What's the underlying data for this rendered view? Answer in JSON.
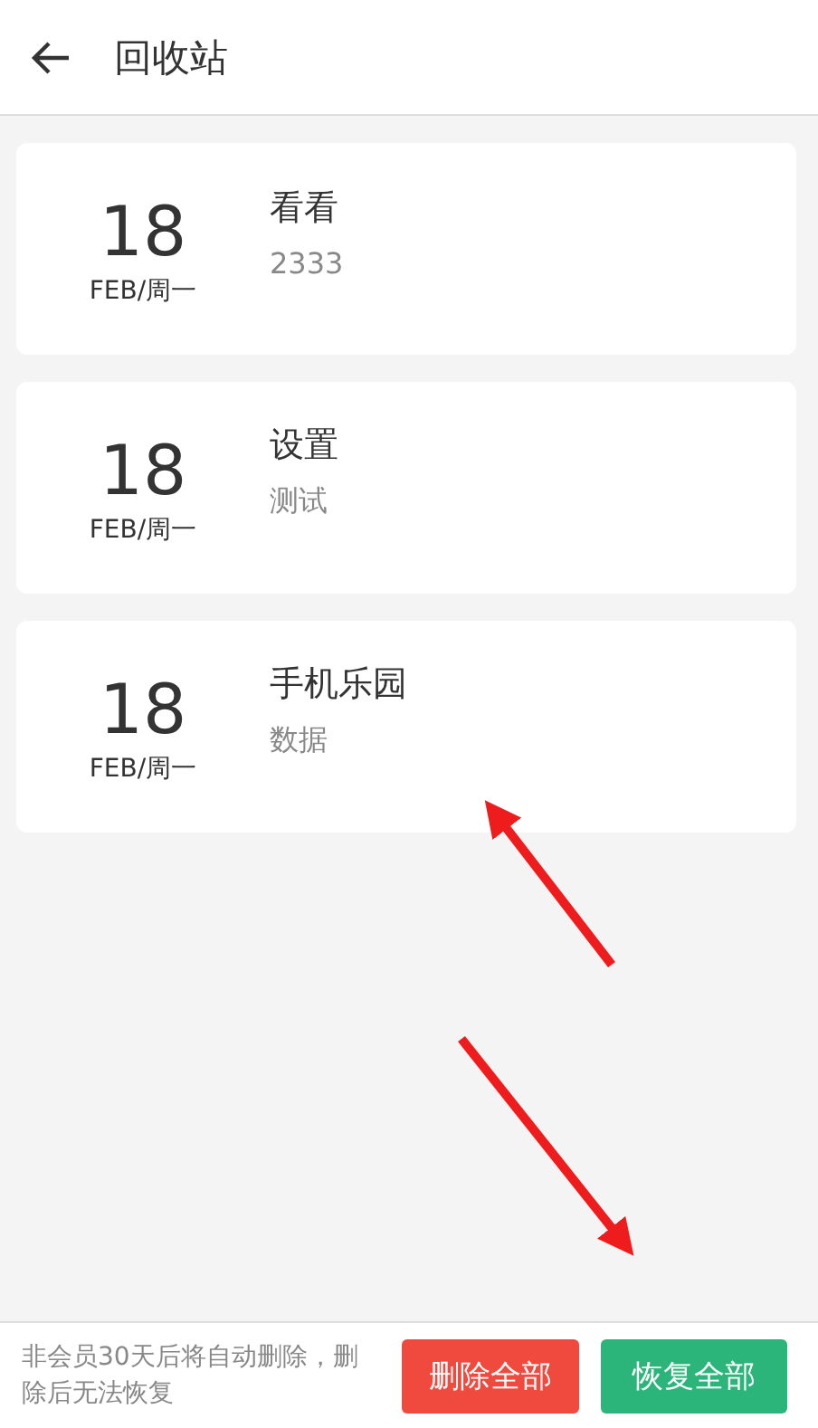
{
  "header": {
    "title": "回收站"
  },
  "notes": [
    {
      "day": "18",
      "month_weekday": "FEB/周一",
      "title": "看看",
      "preview": "2333"
    },
    {
      "day": "18",
      "month_weekday": "FEB/周一",
      "title": "设置",
      "preview": "测试"
    },
    {
      "day": "18",
      "month_weekday": "FEB/周一",
      "title": "手机乐园",
      "preview": "数据"
    }
  ],
  "footer": {
    "notice": "非会员30天后将自动删除，删除后无法恢复",
    "buttons": [
      {
        "label": "删除全部",
        "kind": "delete"
      },
      {
        "label": "恢复全部",
        "kind": "restore"
      }
    ]
  }
}
